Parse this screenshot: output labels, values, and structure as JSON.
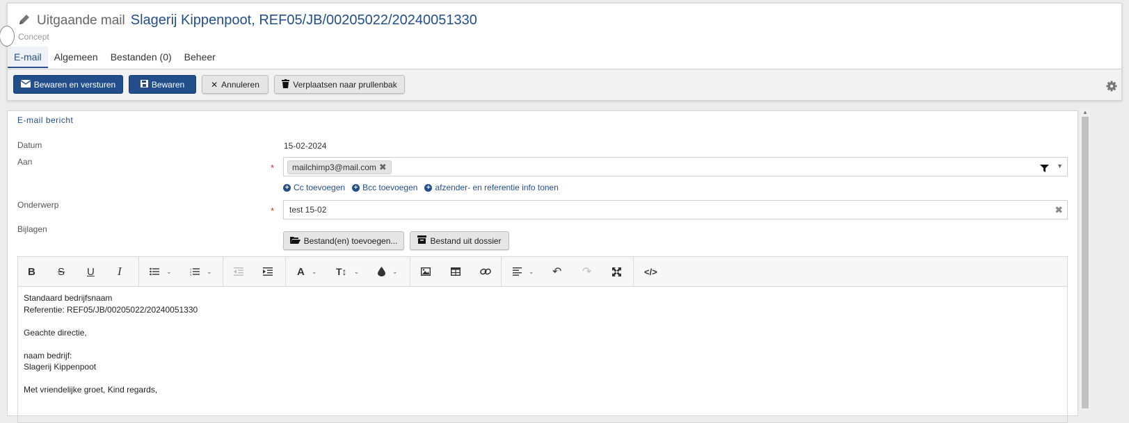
{
  "header": {
    "title_prefix": "Uitgaande mail",
    "title_main": "Slagerij Kippenpoot, REF05/JB/00205022/20240051330",
    "status": "Concept"
  },
  "tabs": [
    {
      "label": "E-mail",
      "active": true
    },
    {
      "label": "Algemeen",
      "active": false
    },
    {
      "label": "Bestanden (0)",
      "active": false
    },
    {
      "label": "Beheer",
      "active": false
    }
  ],
  "toolbar": {
    "save_send": "Bewaren en versturen",
    "save": "Bewaren",
    "cancel": "Annuleren",
    "trash": "Verplaatsen naar prullenbak"
  },
  "form": {
    "section_title": "E-mail bericht",
    "date_label": "Datum",
    "date_value": "15-02-2024",
    "to_label": "Aan",
    "to_recipient": "mailchimp3@mail.com",
    "links": {
      "cc": "Cc toevoegen",
      "bcc": "Bcc toevoegen",
      "sender_info": "afzender- en referentie info tonen"
    },
    "subject_label": "Onderwerp",
    "subject_value": "test 15-02",
    "attachments_label": "Bijlagen",
    "add_files": "Bestand(en) toevoegen...",
    "from_dossier": "Bestand uit dossier"
  },
  "editor": {
    "lines": [
      "Standaard bedrijfsnaam",
      "Referentie: REF05/JB/00205022/20240051330",
      "",
      "Geachte directie,",
      "",
      "naam bedrijf:",
      "Slagerij Kippenpoot",
      "",
      "Met vriendelijke groet, Kind regards,"
    ]
  },
  "colors": {
    "primary": "#234e8c",
    "required": "#c0392b"
  }
}
